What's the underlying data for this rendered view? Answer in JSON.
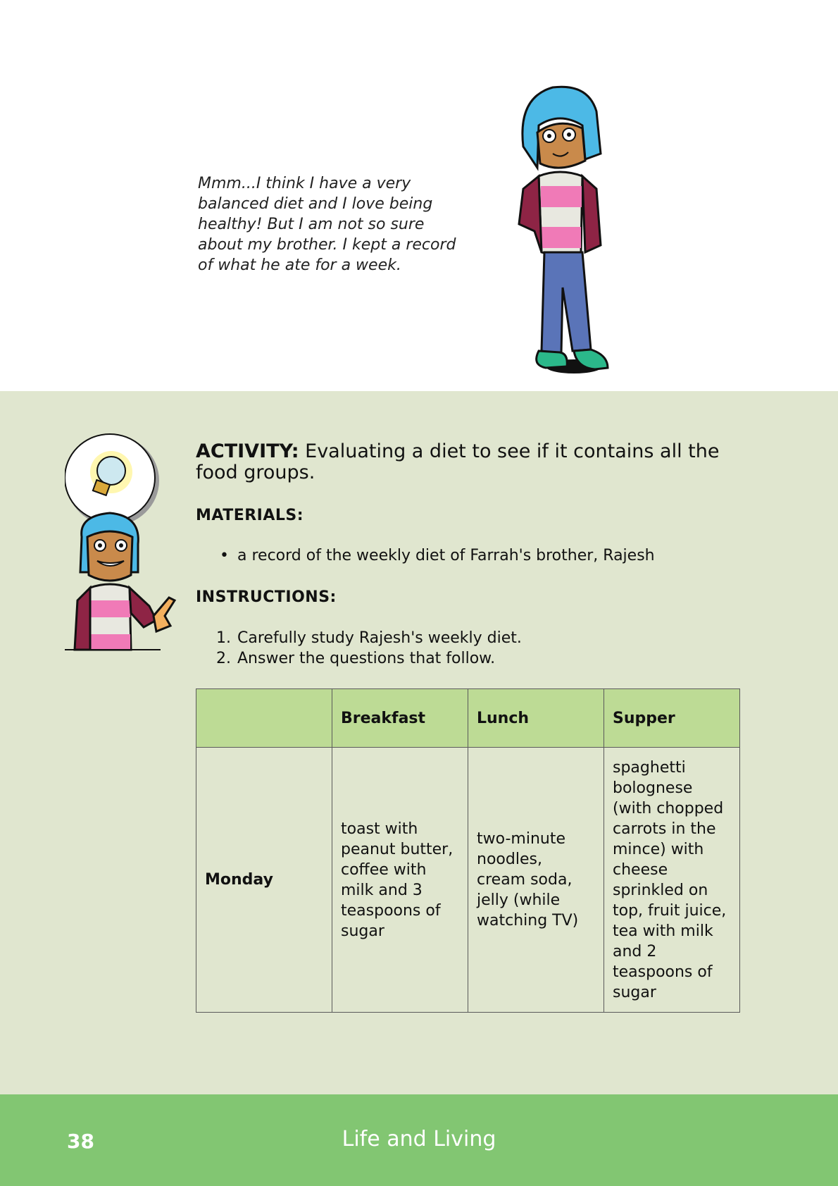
{
  "speech_bubble": {
    "text": "Mmm...I think I have a very balanced diet and I love being healthy! But I am not so sure about my brother.  I kept a record of what he ate for a week."
  },
  "activity": {
    "label": "ACTIVITY:",
    "description": "Evaluating a diet to see if it contains all the food groups.",
    "materials_heading": "MATERIALS:",
    "materials": [
      "a record of the weekly diet of Farrah's brother, Rajesh"
    ],
    "instructions_heading": "INSTRUCTIONS:",
    "instructions": [
      {
        "num": "1.",
        "text": "Carefully study Rajesh's weekly diet."
      },
      {
        "num": "2.",
        "text": "Answer the questions that follow."
      }
    ]
  },
  "diet_table": {
    "headers": [
      "",
      "Breakfast",
      "Lunch",
      "Supper"
    ],
    "rows": [
      {
        "day": "Monday",
        "breakfast": "toast with peanut butter, coffee with milk and 3 teaspoons of sugar",
        "lunch": "two-minute noodles, cream soda, jelly (while watching TV)",
        "supper": "spaghetti bolognese (with chopped carrots in the mince) with cheese sprinkled on top, fruit juice, tea with milk and 2 teaspoons of sugar"
      }
    ]
  },
  "footer": {
    "page_number": "38",
    "title": "Life and Living"
  },
  "colors": {
    "activity_background": "#e0e6cf",
    "table_header": "#bddb95",
    "footer_background": "#82c672"
  }
}
